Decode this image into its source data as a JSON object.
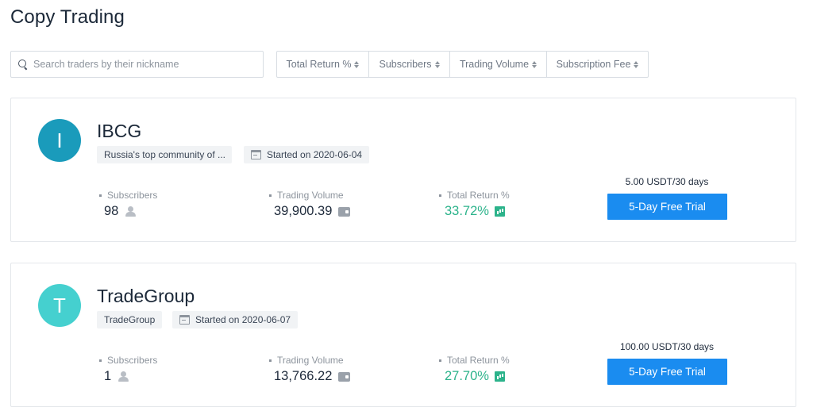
{
  "page_title": "Copy Trading",
  "search": {
    "placeholder": "Search traders by their nickname",
    "value": ""
  },
  "sort_buttons": [
    {
      "label": "Total Return %"
    },
    {
      "label": "Subscribers"
    },
    {
      "label": "Trading Volume"
    },
    {
      "label": "Subscription Fee"
    }
  ],
  "traders": [
    {
      "initial": "I",
      "avatar_color": "#1a9bbb",
      "name": "IBCG",
      "description": "Russia's top community of ...",
      "started": "Started on 2020-06-04",
      "subscribers_label": "Subscribers",
      "subscribers": "98",
      "volume_label": "Trading Volume",
      "volume": "39,900.39",
      "return_label": "Total Return %",
      "return": "33.72%",
      "fee": "5.00 USDT/30 days",
      "trial_label": "5-Day Free Trial"
    },
    {
      "initial": "T",
      "avatar_color": "#45d0cf",
      "name": "TradeGroup",
      "description": "TradeGroup",
      "started": "Started on 2020-06-07",
      "subscribers_label": "Subscribers",
      "subscribers": "1",
      "volume_label": "Trading Volume",
      "volume": "13,766.22",
      "return_label": "Total Return %",
      "return": "27.70%",
      "fee": "100.00 USDT/30 days",
      "trial_label": "5-Day Free Trial"
    }
  ],
  "colors": {
    "accent": "#1a8cf0",
    "positive": "#2cb38b"
  }
}
